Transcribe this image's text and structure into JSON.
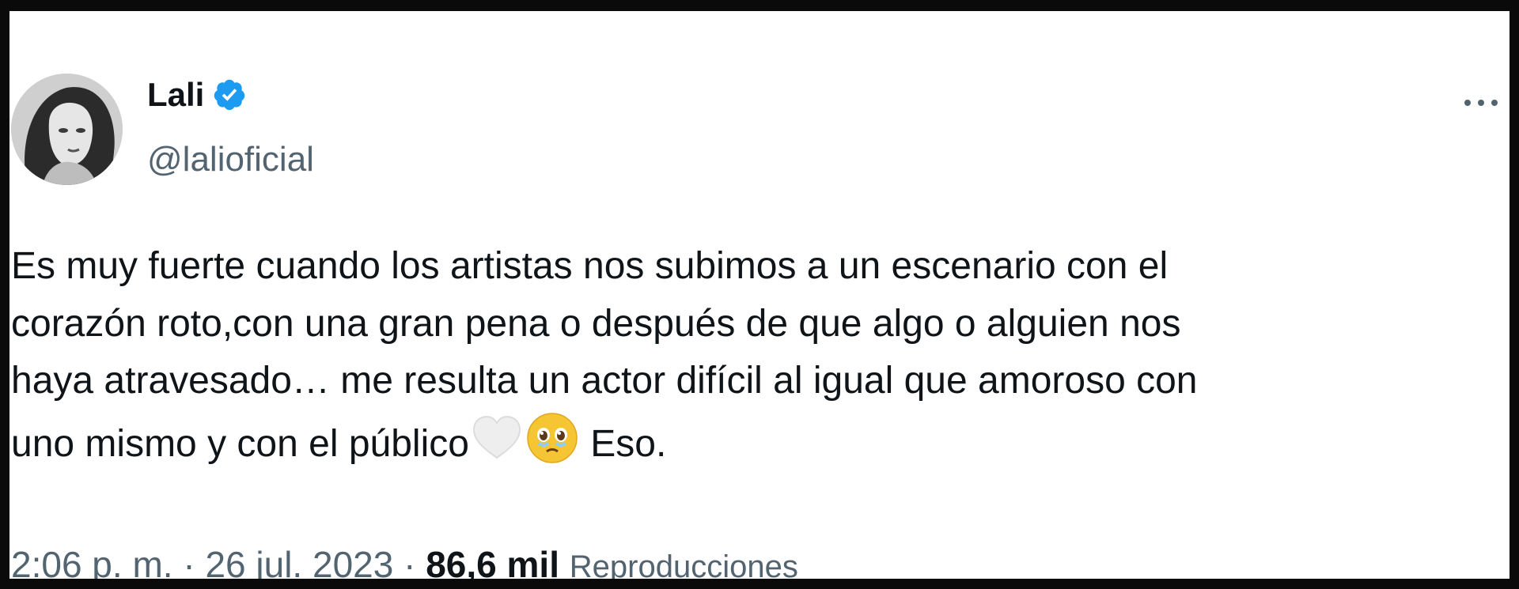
{
  "author": {
    "display_name": "Lali",
    "handle": "@lalioficial",
    "verified": true,
    "avatar_icon": "profile-photo"
  },
  "menu": {
    "more_icon": "ellipsis-icon"
  },
  "tweet": {
    "lines": [
      "Es muy fuerte cuando los artistas nos subimos a un escenario con el",
      "corazón roto,con una gran pena o después de que algo o alguien nos",
      "haya atravesado… me resulta un actor difícil al igual que amoroso con"
    ],
    "last_line_text": "uno mismo y con el público",
    "last_line_end": " Eso.",
    "emojis": [
      "white-heart-icon",
      "face-holding-back-tears-icon"
    ]
  },
  "meta": {
    "time": "2:06 p. m.",
    "separator": "·",
    "date": "26 jul. 2023",
    "views_count": "86,6 mil",
    "views_label": "Reproducciones"
  },
  "colors": {
    "text_primary": "#0f1419",
    "text_secondary": "#536471",
    "verified_blue": "#1d9bf0",
    "border": "#0a0a0a"
  }
}
